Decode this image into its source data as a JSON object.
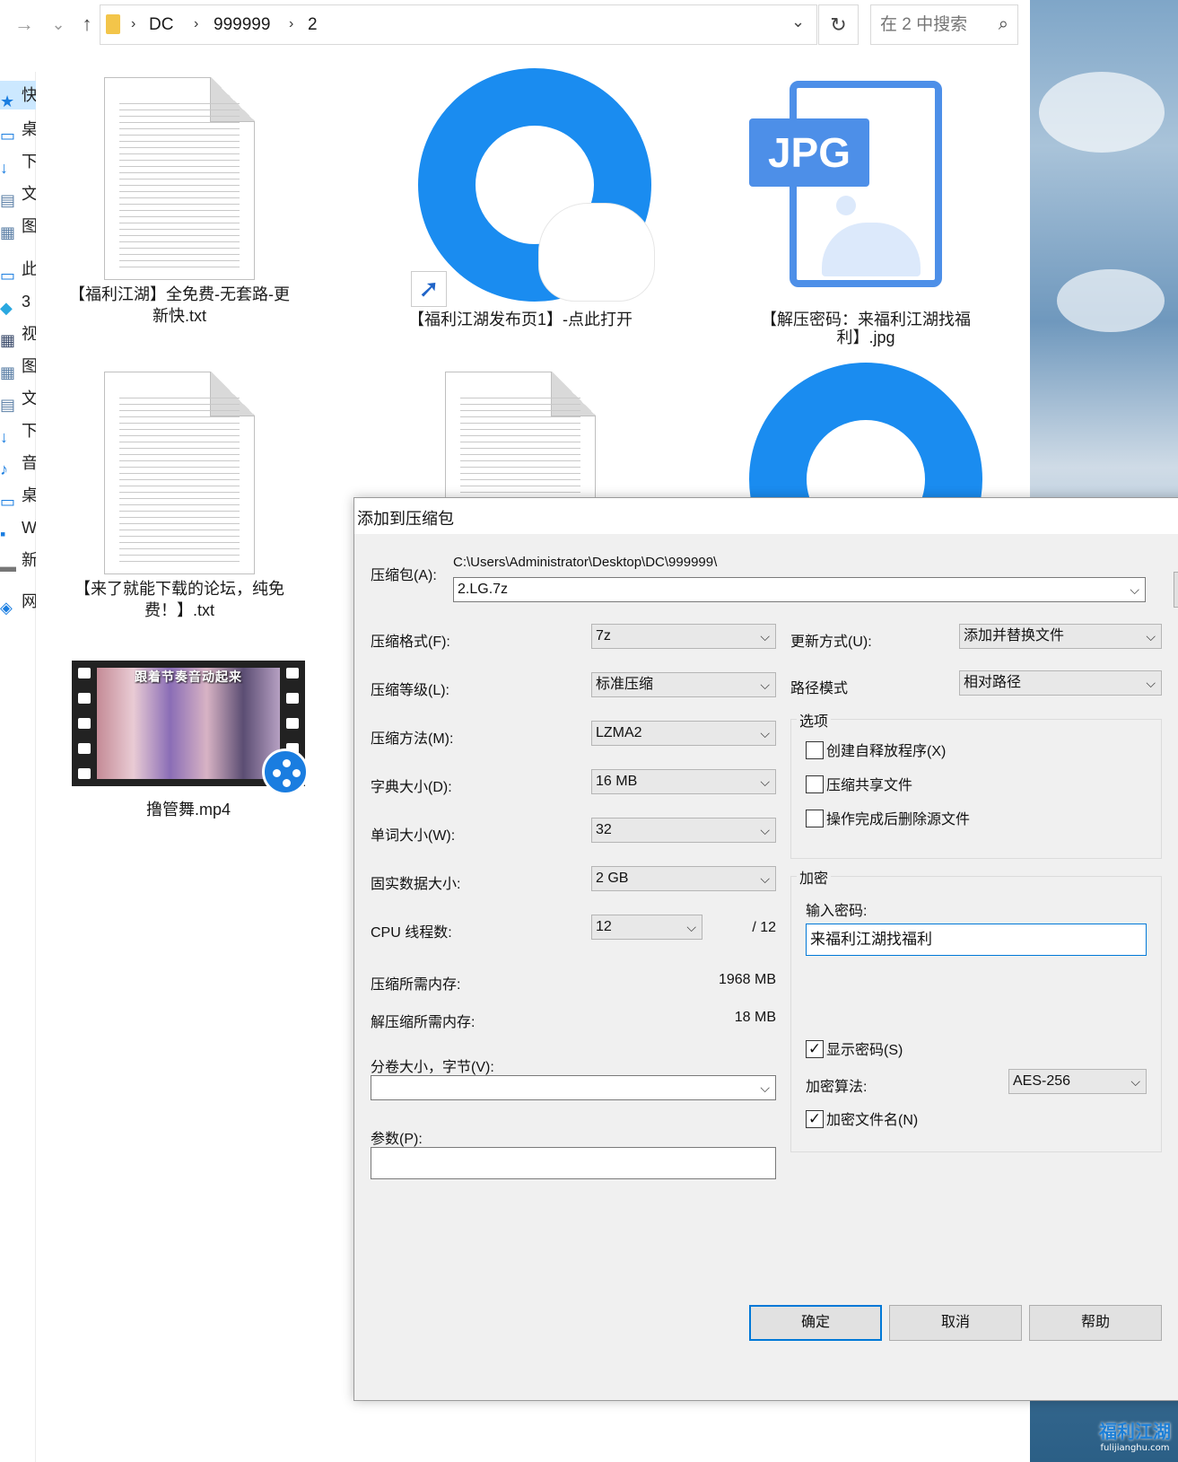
{
  "address_bar": {
    "crumbs": [
      "DC",
      "999999",
      "2"
    ],
    "separator": "›",
    "search_placeholder": "在 2 中搜索"
  },
  "icons": {
    "back": "←",
    "forward": "→",
    "recent": "⌄",
    "up": "↑",
    "dropdown": "⌄",
    "refresh": "↻",
    "search": "⌕",
    "close": "✕",
    "combo_arrow": "⌵",
    "check_mark": "✓",
    "shortcut_arrow": "➚"
  },
  "sidebar": {
    "items": [
      {
        "glyph": "★",
        "label": "快"
      },
      {
        "glyph": "▭",
        "label": "桌"
      },
      {
        "glyph": "↓",
        "label": "下"
      },
      {
        "glyph": "▤",
        "label": "文"
      },
      {
        "glyph": "▦",
        "label": "图"
      },
      {
        "glyph": "▭",
        "label": "此"
      },
      {
        "glyph": "◆",
        "label": "3"
      },
      {
        "glyph": "▦",
        "label": "视"
      },
      {
        "glyph": "▦",
        "label": "图"
      },
      {
        "glyph": "▤",
        "label": "文"
      },
      {
        "glyph": "↓",
        "label": "下"
      },
      {
        "glyph": "♪",
        "label": "音"
      },
      {
        "glyph": "▭",
        "label": "桌"
      },
      {
        "glyph": "▪",
        "label": "W"
      },
      {
        "glyph": "▬",
        "label": "新"
      },
      {
        "glyph": "◈",
        "label": "网"
      }
    ]
  },
  "files": [
    {
      "name_line1": "【福利江湖】全免费-无套路-更",
      "name_line2": "新快.txt"
    },
    {
      "name_line1": "【福利江湖发布页1】-点此打开",
      "name_line2": ""
    },
    {
      "name_line1": "【解压密码：来福利江湖找福",
      "name_line2": "利】.jpg",
      "badge": "JPG"
    },
    {
      "name_line1": "【来了就能下载的论坛，纯免",
      "name_line2": "费！】.txt"
    },
    {
      "name_line1": "撸管舞.mp4",
      "name_line2": "",
      "banner": "跟着节奏音动起来"
    }
  ],
  "dialog": {
    "title": "添加到压缩包",
    "archive_label": "压缩包(A):",
    "archive_path": "C:\\Users\\Administrator\\Desktop\\DC\\999999\\",
    "archive_name": "2.LG.7z",
    "browse_label": "...",
    "format_label": "压缩格式(F):",
    "format_value": "7z",
    "level_label": "压缩等级(L):",
    "level_value": "标准压缩",
    "method_label": "压缩方法(M):",
    "method_value": "LZMA2",
    "dict_label": "字典大小(D):",
    "dict_value": "16 MB",
    "word_label": "单词大小(W):",
    "word_value": "32",
    "solid_label": "固实数据大小:",
    "solid_value": "2 GB",
    "cpu_label": "CPU 线程数:",
    "cpu_value": "12",
    "cpu_max": "/ 12",
    "mem_comp_label": "压缩所需内存:",
    "mem_comp_value": "1968 MB",
    "mem_decomp_label": "解压缩所需内存:",
    "mem_decomp_value": "18 MB",
    "split_label": "分卷大小，字节(V):",
    "split_value": "",
    "params_label": "参数(P):",
    "params_value": "",
    "update_label": "更新方式(U):",
    "update_value": "添加并替换文件",
    "path_mode_label": "路径模式",
    "path_mode_value": "相对路径",
    "options_title": "选项",
    "opt_sfx": "创建自释放程序(X)",
    "opt_shared": "压缩共享文件",
    "opt_delete": "操作完成后删除源文件",
    "encrypt_title": "加密",
    "password_label": "输入密码:",
    "password_value": "来福利江湖找福利",
    "show_password": "显示密码(S)",
    "algo_label": "加密算法:",
    "algo_value": "AES-256",
    "encrypt_names": "加密文件名(N)",
    "ok": "确定",
    "cancel": "取消",
    "help": "帮助"
  },
  "watermark": {
    "logo": "福利江湖",
    "url": "fulijianghu.com"
  },
  "colors": {
    "accent": "#0078d7",
    "qq_blue": "#1a8cf0",
    "jpg_blue": "#4d8fe8"
  }
}
